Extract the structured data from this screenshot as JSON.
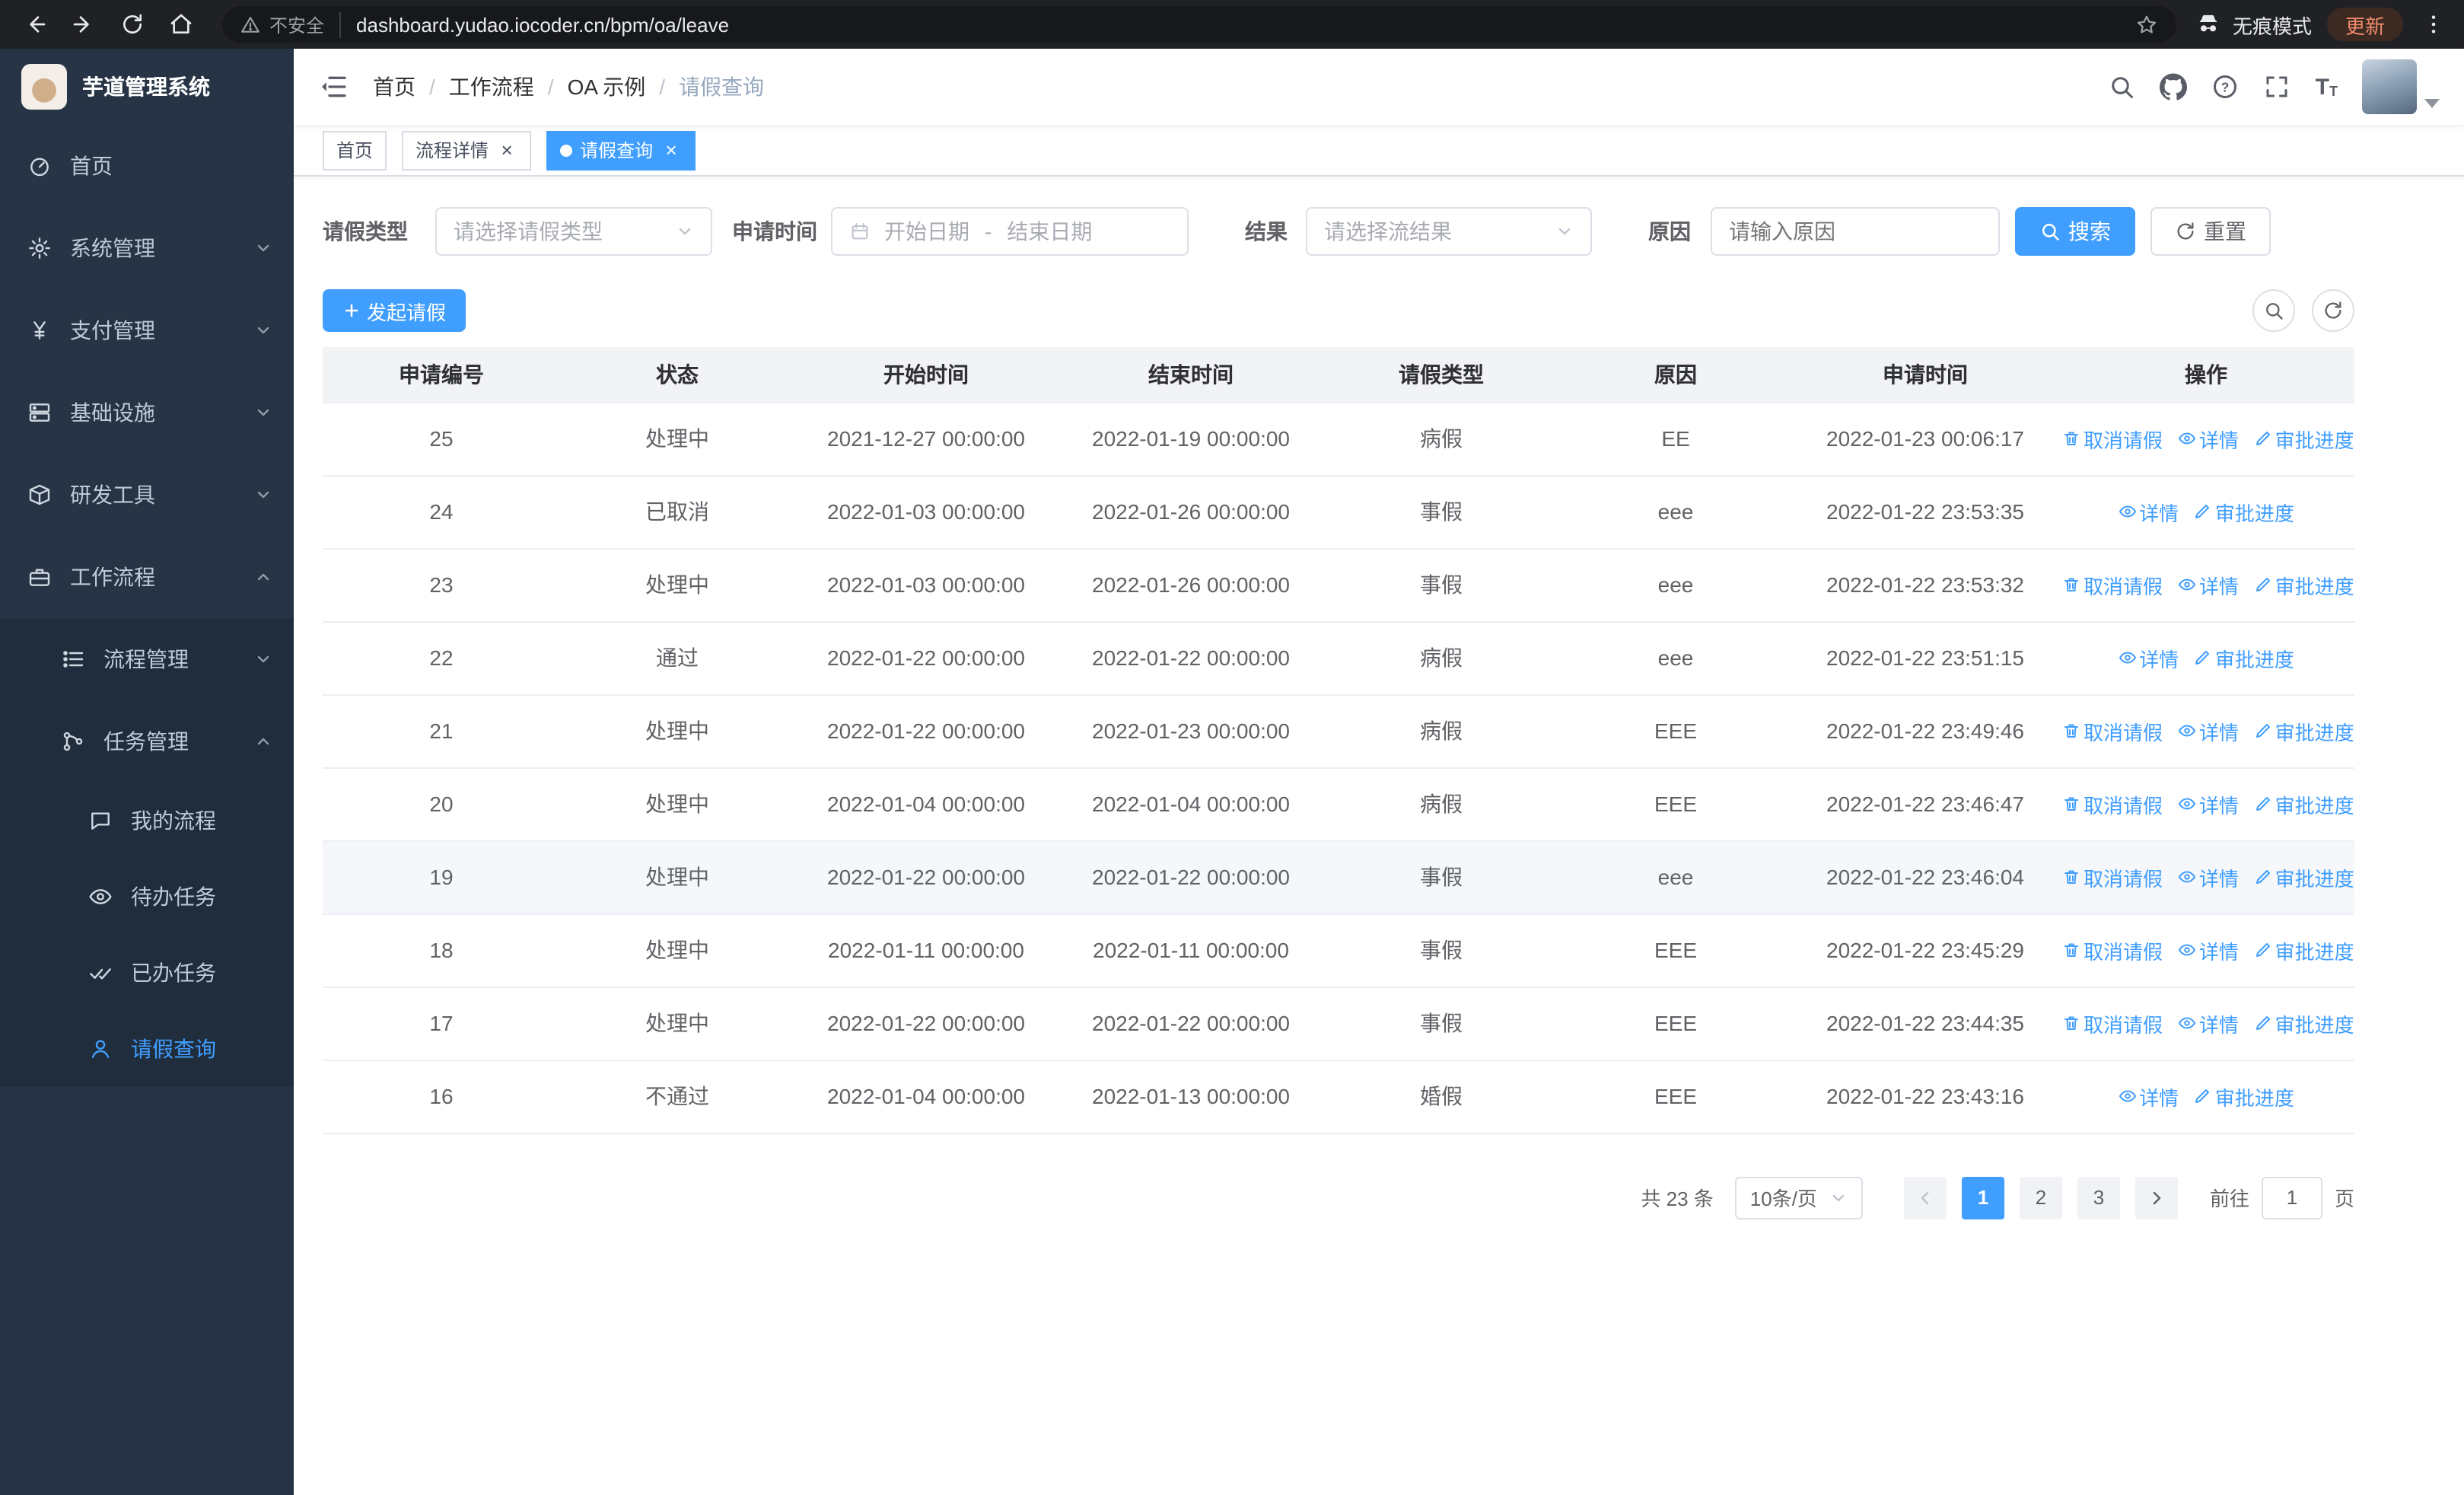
{
  "browser": {
    "security_label": "不安全",
    "url": "dashboard.yudao.iocoder.cn/bpm/oa/leave",
    "incognito_label": "无痕模式",
    "update_label": "更新"
  },
  "sidebar": {
    "logo_title": "芋道管理系统",
    "menu": {
      "home": "首页",
      "system": "系统管理",
      "payment": "支付管理",
      "infrastructure": "基础设施",
      "devtools": "研发工具",
      "workflow": "工作流程",
      "process_management": "流程管理",
      "task_management": "任务管理",
      "my_process": "我的流程",
      "todo_tasks": "待办任务",
      "done_tasks": "已办任务",
      "leave_query": "请假查询"
    }
  },
  "header": {
    "breadcrumb": [
      "首页",
      "工作流程",
      "OA 示例",
      "请假查询"
    ]
  },
  "tabs": [
    {
      "label": "首页"
    },
    {
      "label": "流程详情"
    },
    {
      "label": "请假查询"
    }
  ],
  "filters": {
    "leave_type_label": "请假类型",
    "leave_type_placeholder": "请选择请假类型",
    "apply_time_label": "申请时间",
    "start_date_placeholder": "开始日期",
    "range_separator": "-",
    "end_date_placeholder": "结束日期",
    "result_label": "结果",
    "result_placeholder": "请选择流结果",
    "reason_label": "原因",
    "reason_placeholder": "请输入原因",
    "search_button": "搜索",
    "reset_button": "重置"
  },
  "toolbar": {
    "create_button": "发起请假"
  },
  "table": {
    "headers": [
      "申请编号",
      "状态",
      "开始时间",
      "结束时间",
      "请假类型",
      "原因",
      "申请时间",
      "操作"
    ],
    "op_labels": {
      "cancel": "取消请假",
      "detail": "详情",
      "progress": "审批进度"
    },
    "rows": [
      {
        "id": "25",
        "status": "处理中",
        "start": "2021-12-27 00:00:00",
        "end": "2022-01-19 00:00:00",
        "type": "病假",
        "reason": "EE",
        "applied": "2022-01-23 00:06:17",
        "cancel": true
      },
      {
        "id": "24",
        "status": "已取消",
        "start": "2022-01-03 00:00:00",
        "end": "2022-01-26 00:00:00",
        "type": "事假",
        "reason": "eee",
        "applied": "2022-01-22 23:53:35",
        "cancel": false
      },
      {
        "id": "23",
        "status": "处理中",
        "start": "2022-01-03 00:00:00",
        "end": "2022-01-26 00:00:00",
        "type": "事假",
        "reason": "eee",
        "applied": "2022-01-22 23:53:32",
        "cancel": true
      },
      {
        "id": "22",
        "status": "通过",
        "start": "2022-01-22 00:00:00",
        "end": "2022-01-22 00:00:00",
        "type": "病假",
        "reason": "eee",
        "applied": "2022-01-22 23:51:15",
        "cancel": false
      },
      {
        "id": "21",
        "status": "处理中",
        "start": "2022-01-22 00:00:00",
        "end": "2022-01-23 00:00:00",
        "type": "病假",
        "reason": "EEE",
        "applied": "2022-01-22 23:49:46",
        "cancel": true
      },
      {
        "id": "20",
        "status": "处理中",
        "start": "2022-01-04 00:00:00",
        "end": "2022-01-04 00:00:00",
        "type": "病假",
        "reason": "EEE",
        "applied": "2022-01-22 23:46:47",
        "cancel": true
      },
      {
        "id": "19",
        "status": "处理中",
        "start": "2022-01-22 00:00:00",
        "end": "2022-01-22 00:00:00",
        "type": "事假",
        "reason": "eee",
        "applied": "2022-01-22 23:46:04",
        "cancel": true,
        "row_class": "hover"
      },
      {
        "id": "18",
        "status": "处理中",
        "start": "2022-01-11 00:00:00",
        "end": "2022-01-11 00:00:00",
        "type": "事假",
        "reason": "EEE",
        "applied": "2022-01-22 23:45:29",
        "cancel": true
      },
      {
        "id": "17",
        "status": "处理中",
        "start": "2022-01-22 00:00:00",
        "end": "2022-01-22 00:00:00",
        "type": "事假",
        "reason": "EEE",
        "applied": "2022-01-22 23:44:35",
        "cancel": true
      },
      {
        "id": "16",
        "status": "不通过",
        "start": "2022-01-04 00:00:00",
        "end": "2022-01-13 00:00:00",
        "type": "婚假",
        "reason": "EEE",
        "applied": "2022-01-22 23:43:16",
        "cancel": false
      }
    ]
  },
  "pagination": {
    "total_label": "共 23 条",
    "page_size_label": "10条/页",
    "pages": [
      {
        "n": "1",
        "cls": "active"
      },
      {
        "n": "2"
      },
      {
        "n": "3"
      }
    ],
    "goto_label": "前往",
    "goto_value": "1",
    "goto_suffix": "页"
  },
  "colors": {
    "primary": "#409eff",
    "sidebar_bg": "#263445",
    "submenu_bg": "#1f2d3d"
  }
}
